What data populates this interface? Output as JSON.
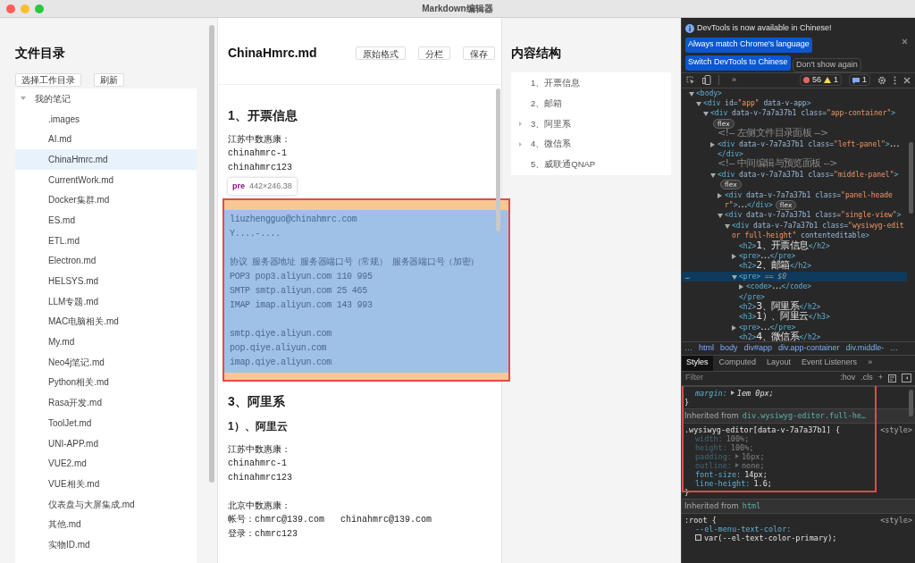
{
  "window": {
    "title": "Markdown编辑器"
  },
  "file_panel": {
    "title": "文件目录",
    "buttons": [
      "选择工作目录",
      "刷新"
    ],
    "tree": {
      "label": "我的笔记",
      "expanded": true,
      "children": [
        {
          "label": ".images",
          "selected": false
        },
        {
          "label": "AI.md",
          "selected": false
        },
        {
          "label": "ChinaHmrc.md",
          "selected": true
        },
        {
          "label": "CurrentWork.md",
          "selected": false
        },
        {
          "label": "Docker集群.md",
          "selected": false
        },
        {
          "label": "ES.md",
          "selected": false
        },
        {
          "label": "ETL.md",
          "selected": false
        },
        {
          "label": "Electron.md",
          "selected": false
        },
        {
          "label": "HELSYS.md",
          "selected": false
        },
        {
          "label": "LLM专题.md",
          "selected": false
        },
        {
          "label": "MAC电脑相关.md",
          "selected": false
        },
        {
          "label": "My.md",
          "selected": false
        },
        {
          "label": "Neo4j笔记.md",
          "selected": false
        },
        {
          "label": "Python相关.md",
          "selected": false
        },
        {
          "label": "Rasa开发.md",
          "selected": false
        },
        {
          "label": "ToolJet.md",
          "selected": false
        },
        {
          "label": "UNI-APP.md",
          "selected": false
        },
        {
          "label": "VUE2.md",
          "selected": false
        },
        {
          "label": "VUE相关.md",
          "selected": false
        },
        {
          "label": "仪表盘与大屏集成.md",
          "selected": false
        },
        {
          "label": "其他.md",
          "selected": false
        },
        {
          "label": "实物ID.md",
          "selected": false
        }
      ]
    }
  },
  "editor": {
    "title": "ChinaHmrc.md",
    "buttons": [
      "原始格式",
      "分栏",
      "保存"
    ],
    "blocks": [
      {
        "kind": "h2",
        "text": "1、开票信息"
      },
      {
        "kind": "p",
        "text": "江苏中数惠康："
      },
      {
        "kind": "pre",
        "lines": [
          "chinahmrc-1",
          "chinahmrc123"
        ]
      },
      {
        "kind": "inspected",
        "tag": "pre",
        "size": "442×246.38",
        "groups": [
          [
            "liuzhengguo@chinahmrc.com",
            "Y....-...."
          ],
          [
            "协议 服务器地址 服务器端口号（常规） 服务器端口号（加密）",
            "POP3 pop3.aliyun.com 110 995",
            "SMTP smtp.aliyun.com 25 465",
            "IMAP imap.aliyun.com 143 993"
          ],
          [
            "smtp.qiye.aliyun.com",
            "pop.qiye.aliyun.com",
            "imap.qiye.aliyun.com"
          ]
        ]
      },
      {
        "kind": "h2",
        "text": "3、阿里系"
      },
      {
        "kind": "h3",
        "text": "1）、阿里云"
      },
      {
        "kind": "p",
        "text": "江苏中数惠康："
      },
      {
        "kind": "pre",
        "lines": [
          "chinahmrc-1",
          "chinahmrc123"
        ]
      },
      {
        "kind": "p",
        "text": "北京中数惠康："
      },
      {
        "kind": "pre",
        "lines": [
          "帐号：chmrc@139.com   chinahmrc@139.com",
          "登录：chmrc123"
        ]
      }
    ]
  },
  "outline": {
    "title": "内容结构",
    "items": [
      {
        "label": "1、开票信息",
        "collapsed": false
      },
      {
        "label": "2、邮箱",
        "collapsed": false
      },
      {
        "label": "3、阿里系",
        "collapsed": true
      },
      {
        "label": "4、微信系",
        "collapsed": true
      },
      {
        "label": "5、威联通QNAP",
        "collapsed": false
      }
    ]
  },
  "devtools": {
    "banner": {
      "message": "DevTools is now available in Chinese!",
      "buttons": [
        "Always match Chrome's language",
        "Switch DevTools to Chinese"
      ],
      "dismiss": "Don't show again"
    },
    "toolbar": {
      "more": "»",
      "errors": "56",
      "warnings": "1",
      "messages": "1"
    },
    "row_menu": "…",
    "elements": [
      {
        "segs": [
          {
            "kind": "tag",
            "t": "<body>"
          }
        ],
        "expanded": true,
        "selected": false,
        "children": [
          {
            "segs": [
              {
                "kind": "tag",
                "t": "<div "
              },
              {
                "kind": "attr",
                "t": "id="
              },
              {
                "kind": "val",
                "t": "\"app\""
              },
              {
                "kind": "attr",
                "t": " data-v-app"
              },
              {
                "kind": "tag",
                "t": ">"
              }
            ],
            "expanded": true,
            "selected": false,
            "children": [
              {
                "segs": [
                  {
                    "kind": "tag",
                    "t": "<div "
                  },
                  {
                    "kind": "attr",
                    "t": "data-v-7a7a37b1 class="
                  },
                  {
                    "kind": "val",
                    "t": "\"app-container\""
                  },
                  {
                    "kind": "tag",
                    "t": ">"
                  }
                ],
                "badge": "flex",
                "expanded": true,
                "selected": false,
                "children": [
                  {
                    "segs": [
                      {
                        "kind": "comment",
                        "t": "<!-- 左侧文件目录面板 -->"
                      }
                    ],
                    "selected": false
                  },
                  {
                    "segs": [
                      {
                        "kind": "tag",
                        "t": "<div "
                      },
                      {
                        "kind": "attr",
                        "t": "data-v-7a7a37b1 class="
                      },
                      {
                        "kind": "val",
                        "t": "\"left-panel\""
                      },
                      {
                        "kind": "tag",
                        "t": ">"
                      },
                      {
                        "kind": "text",
                        "t": "…"
                      }
                    ],
                    "close": "</div>",
                    "expanded": false,
                    "selected": false
                  },
                  {
                    "segs": [
                      {
                        "kind": "comment",
                        "t": "<!-- 中间编辑与预览面板 -->"
                      }
                    ],
                    "selected": false
                  },
                  {
                    "segs": [
                      {
                        "kind": "tag",
                        "t": "<div "
                      },
                      {
                        "kind": "attr",
                        "t": "data-v-7a7a37b1 class="
                      },
                      {
                        "kind": "val",
                        "t": "\"middle-panel\""
                      },
                      {
                        "kind": "tag",
                        "t": ">"
                      }
                    ],
                    "badge": "flex",
                    "expanded": true,
                    "selected": false,
                    "children": [
                      {
                        "segs": [
                          {
                            "kind": "tag",
                            "t": "<div "
                          },
                          {
                            "kind": "attr",
                            "t": "data-v-7a7a37b1 class="
                          },
                          {
                            "kind": "val",
                            "t": "\"panel-header\""
                          },
                          {
                            "kind": "tag",
                            "t": ">"
                          },
                          {
                            "kind": "text",
                            "t": "…"
                          },
                          {
                            "kind": "tag",
                            "t": "</div>"
                          }
                        ],
                        "badge": "flex",
                        "expanded": false,
                        "selected": false
                      },
                      {
                        "segs": [
                          {
                            "kind": "tag",
                            "t": "<div "
                          },
                          {
                            "kind": "attr",
                            "t": "data-v-7a7a37b1 class="
                          },
                          {
                            "kind": "val",
                            "t": "\"single-view\""
                          },
                          {
                            "kind": "tag",
                            "t": ">"
                          }
                        ],
                        "expanded": true,
                        "selected": false,
                        "children": [
                          {
                            "segs": [
                              {
                                "kind": "tag",
                                "t": "<div "
                              },
                              {
                                "kind": "attr",
                                "t": "data-v-7a7a37b1 class="
                              },
                              {
                                "kind": "val",
                                "t": "\"wysiwyg-editor full-height\""
                              },
                              {
                                "kind": "attr",
                                "t": " contenteditable"
                              },
                              {
                                "kind": "tag",
                                "t": ">"
                              }
                            ],
                            "expanded": true,
                            "selected": false,
                            "children": [
                              {
                                "segs": [
                                  {
                                    "kind": "tag",
                                    "t": "<h2>"
                                  },
                                  {
                                    "kind": "text",
                                    "t": "1、开票信息"
                                  },
                                  {
                                    "kind": "tag",
                                    "t": "</h2>"
                                  }
                                ],
                                "selected": false
                              },
                              {
                                "segs": [
                                  {
                                    "kind": "tag",
                                    "t": "<pre>"
                                  },
                                  {
                                    "kind": "text",
                                    "t": "…"
                                  },
                                  {
                                    "kind": "tag",
                                    "t": "</pre>"
                                  }
                                ],
                                "expanded": false,
                                "selected": false
                              },
                              {
                                "segs": [
                                  {
                                    "kind": "tag",
                                    "t": "<h2>"
                                  },
                                  {
                                    "kind": "text",
                                    "t": "2、邮箱"
                                  },
                                  {
                                    "kind": "tag",
                                    "t": "</h2>"
                                  }
                                ],
                                "selected": false
                              },
                              {
                                "segs": [
                                  {
                                    "kind": "tag",
                                    "t": "<pre>"
                                  },
                                  {
                                    "kind": "ref",
                                    "t": " == $0"
                                  }
                                ],
                                "close": "</pre>",
                                "expanded": true,
                                "selected": true,
                                "children": [
                                  {
                                    "segs": [
                                      {
                                        "kind": "tag",
                                        "t": "<code>"
                                      },
                                      {
                                        "kind": "text",
                                        "t": "…"
                                      },
                                      {
                                        "kind": "tag",
                                        "t": "</code>"
                                      }
                                    ],
                                    "expanded": false,
                                    "selected": false
                                  }
                                ]
                              },
                              {
                                "segs": [
                                  {
                                    "kind": "tag",
                                    "t": "<h2>"
                                  },
                                  {
                                    "kind": "text",
                                    "t": "3、阿里系"
                                  },
                                  {
                                    "kind": "tag",
                                    "t": "</h2>"
                                  }
                                ],
                                "selected": false
                              },
                              {
                                "segs": [
                                  {
                                    "kind": "tag",
                                    "t": "<h3>"
                                  },
                                  {
                                    "kind": "text",
                                    "t": "1）、阿里云"
                                  },
                                  {
                                    "kind": "tag",
                                    "t": "</h3>"
                                  }
                                ],
                                "selected": false
                              },
                              {
                                "segs": [
                                  {
                                    "kind": "tag",
                                    "t": "<pre>"
                                  },
                                  {
                                    "kind": "text",
                                    "t": "…"
                                  },
                                  {
                                    "kind": "tag",
                                    "t": "</pre>"
                                  }
                                ],
                                "expanded": false,
                                "selected": false
                              },
                              {
                                "segs": [
                                  {
                                    "kind": "tag",
                                    "t": "<h2>"
                                  },
                                  {
                                    "kind": "text",
                                    "t": "4、微信系"
                                  },
                                  {
                                    "kind": "tag",
                                    "t": "</h2>"
                                  }
                                ],
                                "selected": false
                              }
                            ]
                          }
                        ]
                      }
                    ]
                  }
                ]
              }
            ]
          }
        ]
      }
    ],
    "breadcrumbs": [
      "…",
      "html",
      "body",
      "div#app",
      "div.app-container",
      "div.middle-",
      "…"
    ],
    "tabs": [
      {
        "label": "Styles",
        "selected": true
      },
      {
        "label": "Computed",
        "selected": false
      },
      {
        "label": "Layout",
        "selected": false
      },
      {
        "label": "Event Listeners",
        "selected": false
      }
    ],
    "tabs_more": "»",
    "filter": {
      "placeholder": "Filter",
      "hov": ":hov",
      "cls": ".cls",
      "add": "+"
    },
    "sections": [
      {
        "kind": "rule",
        "declarations": [
          {
            "name": "margin:",
            "value": "1em 0px;",
            "expandable": true,
            "inactive": false,
            "italic": true
          }
        ],
        "close": "}"
      },
      {
        "kind": "inherited",
        "label": "Inherited from",
        "link": "div.wysiwyg-editor.full-he…"
      },
      {
        "kind": "rule",
        "selector": ".wysiwyg-editor[data-v-7a7a37b1] {",
        "source": "<style>",
        "declarations": [
          {
            "name": "width:",
            "value": "100%;",
            "expandable": false,
            "inactive": true
          },
          {
            "name": "height:",
            "value": "100%;",
            "expandable": false,
            "inactive": true
          },
          {
            "name": "padding:",
            "value": "16px;",
            "expandable": true,
            "inactive": true
          },
          {
            "name": "outline:",
            "value": "none;",
            "expandable": true,
            "inactive": true
          },
          {
            "name": "font-size:",
            "value": "14px;",
            "expandable": false,
            "inactive": false
          },
          {
            "name": "line-height:",
            "value": "1.6;",
            "expandable": false,
            "inactive": false
          }
        ],
        "close": "}"
      },
      {
        "kind": "inherited",
        "label": "Inherited from",
        "link": "html"
      },
      {
        "kind": "rule",
        "selector": ":root {",
        "source": "<style>",
        "declarations": [
          {
            "name": "--el-menu-text-color:",
            "value": "var(--el-text-color-primary);",
            "expandable": false,
            "inactive": false,
            "swatch": true
          }
        ]
      }
    ]
  }
}
